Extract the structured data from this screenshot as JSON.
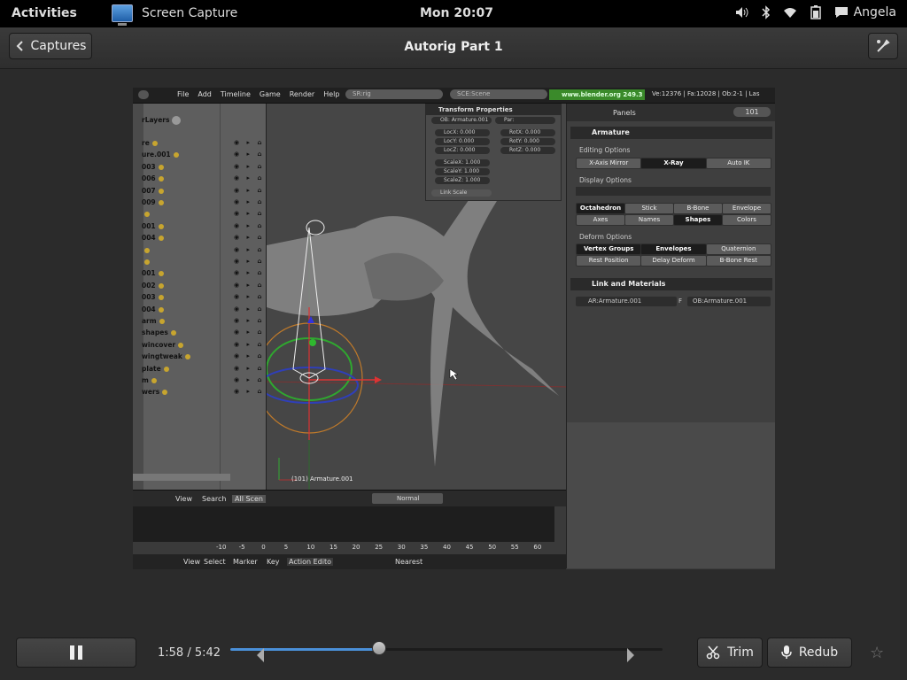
{
  "topbar": {
    "activities": "Activities",
    "app_name": "Screen Capture",
    "clock": "Mon 20:07",
    "user": "Angela"
  },
  "header": {
    "back_label": "Captures",
    "title": "Autorig Part 1"
  },
  "video": {
    "blender": {
      "menus": [
        "File",
        "Add",
        "Timeline",
        "Game",
        "Render",
        "Help"
      ],
      "screen_field": "SR:rig",
      "scene_field": "SCE:Scene",
      "url": "www.blender.org 249.3",
      "stats": "Ve:12376 | Fa:12028 | Ob:2-1 | Las",
      "outliner_header": "rLayers",
      "outliner_rows": [
        "re",
        "ure.001",
        "003",
        "006",
        "007",
        "009",
        "",
        "001",
        "004",
        "",
        "",
        "001",
        "002",
        "003",
        "004",
        "arm",
        "shapes",
        "wincover",
        "wingtweak",
        "plate",
        "m",
        "wers"
      ],
      "outliner_footer": {
        "view": "View",
        "search": "Search",
        "scope": "All Scen"
      },
      "transform": {
        "title": "Transform Properties",
        "ob": "OB: Armature.001",
        "par": "Par:",
        "loc": [
          "LocX: 0.000",
          "LocY: 0.000",
          "LocZ: 0.000"
        ],
        "rot": [
          "RotX: 0.000",
          "RotY: 0.000",
          "RotZ: 0.000"
        ],
        "scale": [
          "ScaleX: 1.000",
          "ScaleY: 1.000",
          "ScaleZ: 1.000"
        ],
        "link_scale": "Link Scale"
      },
      "viewport_label": "(101) Armature.001",
      "viewport_mode": "Normal",
      "props": {
        "panels_label": "Panels",
        "frame": "101",
        "armature_title": "Armature",
        "editing_options": "Editing Options",
        "editing_buttons": [
          "X-Axis Mirror",
          "X-Ray",
          "Auto IK"
        ],
        "display_options": "Display Options",
        "display_row1": [
          "Octahedron",
          "Stick",
          "B-Bone",
          "Envelope"
        ],
        "display_row2": [
          "Axes",
          "Names",
          "Shapes",
          "Colors"
        ],
        "deform_options": "Deform Options",
        "deform_row1": [
          "Vertex Groups",
          "Envelopes",
          "Quaternion"
        ],
        "deform_row2": [
          "Rest Position",
          "Delay Deform",
          "B-Bone Rest"
        ],
        "link_title": "Link and Materials",
        "ar_field": "AR:Armature.001",
        "f_label": "F",
        "ob_field": "OB:Armature.001"
      },
      "timeline": {
        "ticks": [
          "-10",
          "-5",
          "0",
          "5",
          "10",
          "15",
          "20",
          "25",
          "30",
          "35",
          "40",
          "45",
          "50",
          "55",
          "60"
        ],
        "menus": [
          "View",
          "Select",
          "Marker",
          "Key"
        ],
        "mode": "Action Edito",
        "snap": "Nearest"
      }
    }
  },
  "player": {
    "time_label": "1:58 / 5:42",
    "progress": 0.344,
    "trim_label": "Trim",
    "redub_label": "Redub"
  },
  "colors": {
    "accent": "#4a90d9",
    "blender_url_bg": "#3a8a2a"
  }
}
